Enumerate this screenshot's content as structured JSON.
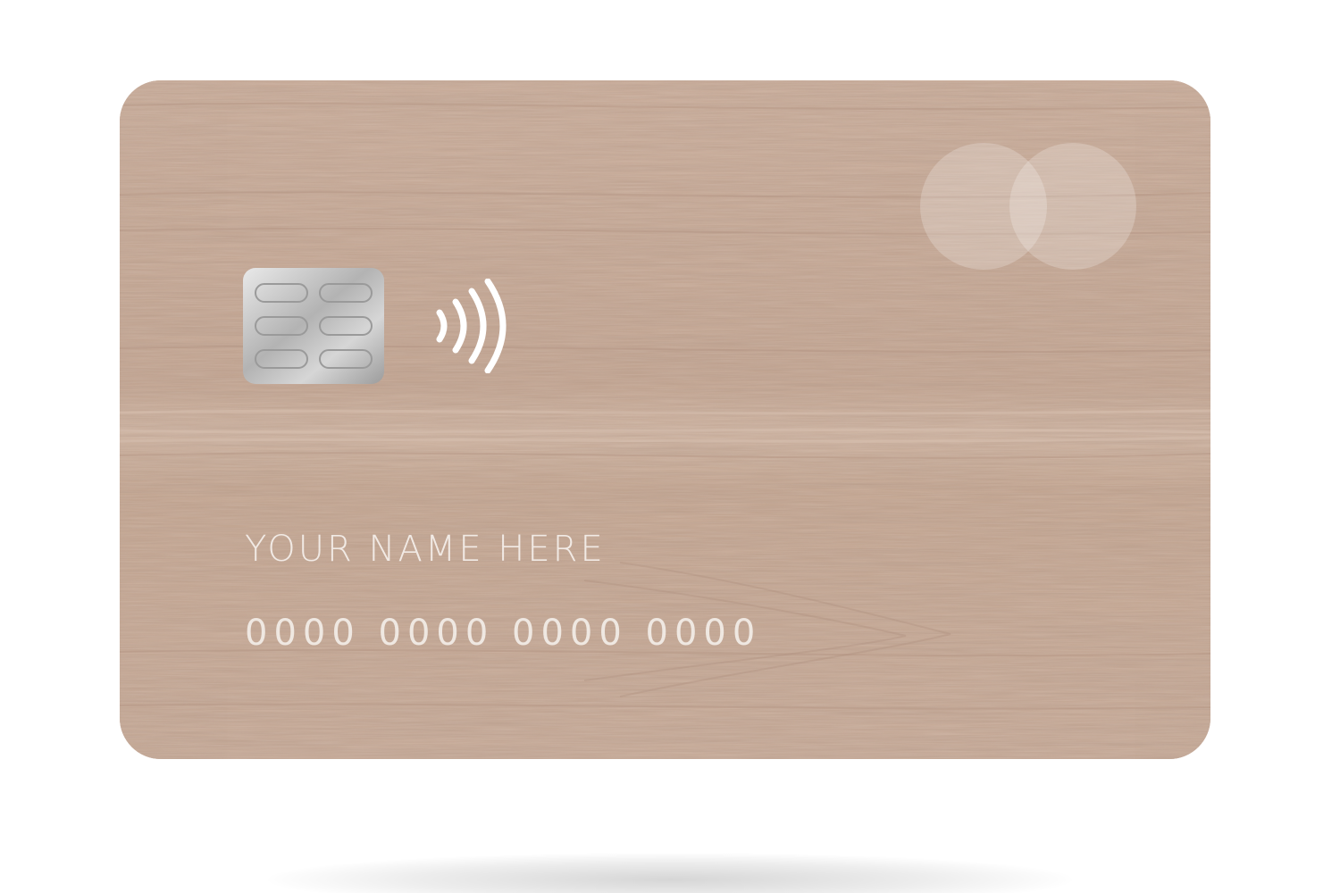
{
  "card": {
    "holder_name": "YOUR NAME HERE",
    "number": "0000 0000 0000 0000",
    "chip": "emv-chip-icon",
    "contactless": "contactless-icon",
    "brand": "overlapping-circles-logo"
  },
  "colors": {
    "wood_base": "#c5a896",
    "wood_light": "#d6bcab",
    "wood_dark": "#a8897a",
    "text": "#f5f0ec",
    "chip_silver": "#b9b9b9"
  }
}
